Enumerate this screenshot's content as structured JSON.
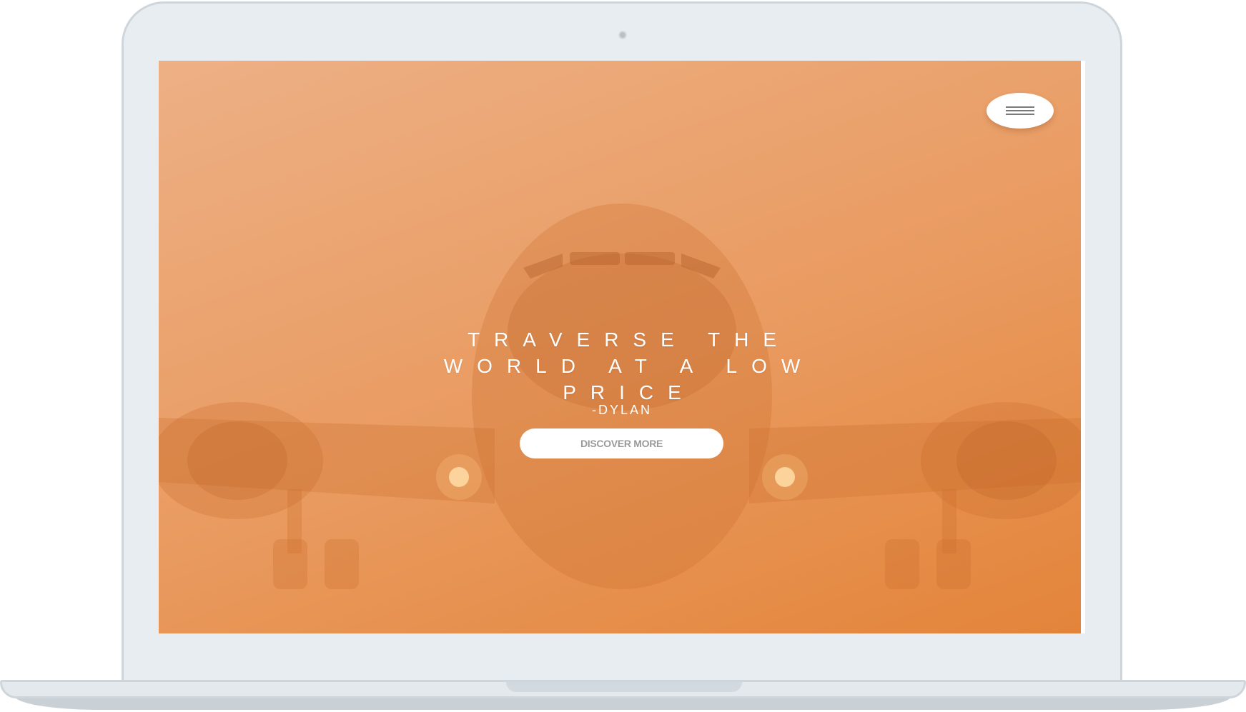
{
  "hero": {
    "title": "TRAVERSE THE WORLD AT A LOW PRICE",
    "author": "-DYLAN",
    "cta_label": "DISCOVER MORE"
  },
  "header": {
    "menu_icon": "hamburger-menu-icon"
  },
  "colors": {
    "hero_overlay_start": "#edb085",
    "hero_overlay_end": "#e3843a",
    "device_frame": "#e8edf1",
    "button_bg": "#ffffff",
    "button_text": "#9a9a9a"
  }
}
